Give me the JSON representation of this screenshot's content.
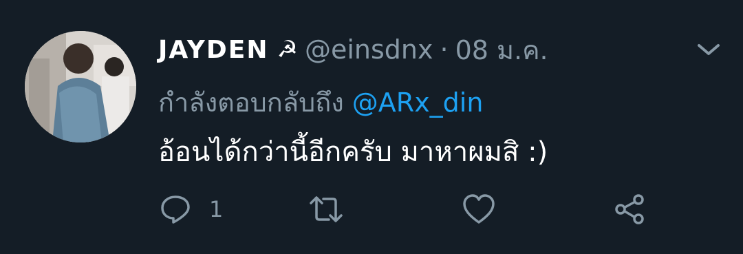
{
  "tweet": {
    "display_name": "JAYDEN",
    "name_emoji": "☭",
    "handle": "@einsdnx",
    "separator": "·",
    "date": "08 ม.ค.",
    "reply_prefix": "กำลังตอบกลับถึง",
    "reply_mention": "@ARx_din",
    "text": "อ้อนได้กว่านี้อีกครับ มาหาผมสิ :)"
  },
  "actions": {
    "reply_count": "1",
    "reply_icon": "reply-icon",
    "retweet_icon": "retweet-icon",
    "like_icon": "heart-icon",
    "share_icon": "share-icon"
  },
  "colors": {
    "background": "#141d26",
    "text_primary": "#ffffff",
    "text_secondary": "#8899a6",
    "link": "#1da1f2"
  }
}
